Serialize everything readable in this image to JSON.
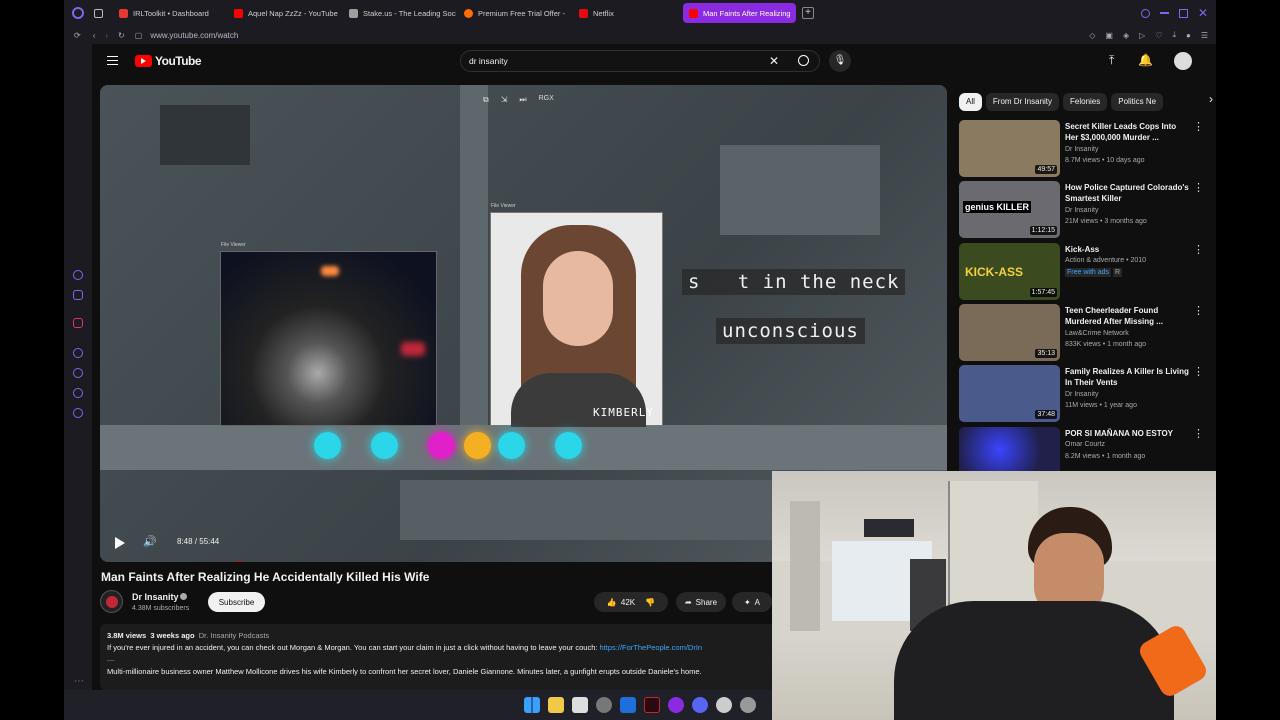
{
  "browser": {
    "tabs": [
      {
        "label": "IRLToolkit • Dashboard",
        "color": "#e53935"
      },
      {
        "label": "Aquel Nap ZzZz - YouTube",
        "color": "#ff0000"
      },
      {
        "label": "Stake.us - The Leading Social",
        "color": "#9e9e9e"
      },
      {
        "label": "Premium Free Trial Offer -",
        "color": "#ff6d00"
      },
      {
        "label": "Netflix",
        "color": "#e50914"
      },
      {
        "label": "Man Faints After Realizing",
        "color": "#ff0000"
      }
    ],
    "url": "www.youtube.com/watch"
  },
  "youtube": {
    "logo_text": "YouTube",
    "search_value": "dr insanity",
    "video": {
      "caption_line1": "s   t in the neck",
      "caption_line2": "unconscious",
      "name_label": "KIMBERLY",
      "file_viewer_label": "File Viewer",
      "time": "8:48 / 55:44",
      "progress_fraction": 0.157,
      "overlay_label": "RGX"
    },
    "title": "Man Faints After Realizing He Accidentally Killed His Wife",
    "channel": {
      "name": "Dr Insanity",
      "subscribers": "4.38M subscribers"
    },
    "subscribe_label": "Subscribe",
    "likes": "42K",
    "share_label": "Share",
    "more_action_label": "A",
    "description": {
      "views": "3.8M views",
      "date": "3 weeks ago",
      "tag": "Dr. Insanity Podcasts",
      "line1": "If you're ever injured in an accident, you can check out Morgan & Morgan. You can start your claim in just a click without having to leave your couch:",
      "link": "https://ForThePeople.com/DrIn",
      "line2": "Multi-millionaire business owner Matthew Mollicone drives his wife Kimberly to confront her secret lover, Daniele Giannone. Minutes later, a gunfight erupts outside Daniele's home."
    },
    "chips": [
      "All",
      "From Dr Insanity",
      "Felonies",
      "Politics Ne"
    ],
    "related": [
      {
        "title": "Secret Killer Leads Cops Into Her $3,000,000 Murder ...",
        "channel": "Dr Insanity",
        "meta": "8.7M views • 10 days ago",
        "duration": "49:57",
        "thumb_color": "#8a7a60"
      },
      {
        "title": "How Police Captured Colorado's Smartest Killer",
        "channel": "Dr Insanity",
        "meta": "21M views • 3 months ago",
        "duration": "1:12:15",
        "thumb_color": "#6a6a70",
        "thumb_text": "genius KILLER"
      },
      {
        "title": "Kick-Ass",
        "channel": "Action & adventure • 2010",
        "meta": "Free with ads",
        "rating": "R",
        "duration": "1:57:45",
        "thumb_color": "#3c4a20",
        "thumb_text": "KICK-ASS"
      },
      {
        "title": "Teen Cheerleader Found Murdered After Missing ...",
        "channel": "Law&Crime Network",
        "meta": "833K views • 1 month ago",
        "duration": "35:13",
        "thumb_color": "#7a6a58"
      },
      {
        "title": "Family Realizes A Killer Is Living In Their Vents",
        "channel": "Dr Insanity",
        "meta": "11M views • 1 year ago",
        "duration": "37:48",
        "thumb_color": "#4a5a8a"
      },
      {
        "title": "POR SI MAÑANA NO ESTOY",
        "channel": "Omar Courtz",
        "meta": "8.2M views • 1 month ago",
        "duration": "",
        "thumb_color": "#20204a"
      }
    ]
  }
}
